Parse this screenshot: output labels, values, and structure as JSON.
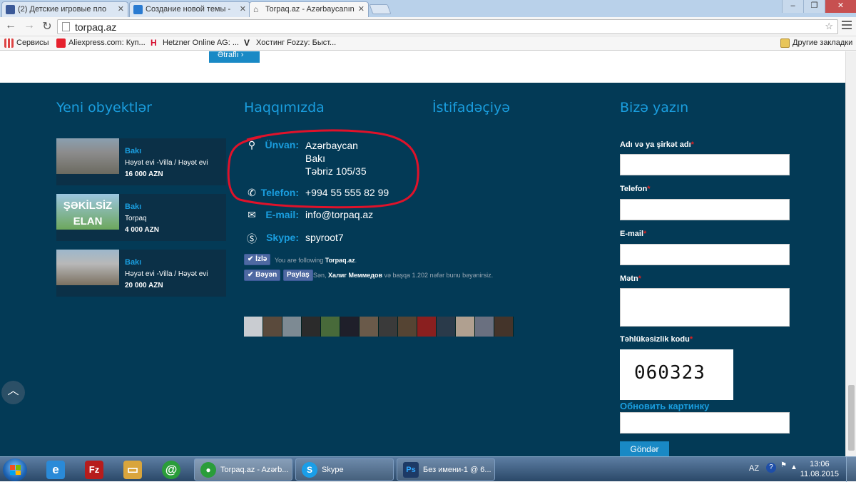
{
  "browser": {
    "tabs": [
      {
        "title": "(2) Детские игровые пло",
        "icon_color": "#3b5998",
        "icon": "facebook-icon"
      },
      {
        "title": "Создание новой темы - ",
        "icon_color": "#2a7bd1",
        "icon": "forum-icon"
      },
      {
        "title": "Torpaq.az - Azərbaycanın",
        "icon_color": "#555555",
        "icon": "home-icon"
      }
    ],
    "url": "torpaq.az",
    "bookmarks": [
      {
        "label": "Сервисы",
        "icon": "apps-icon",
        "color": "#d44"
      },
      {
        "label": "Aliexpress.com: Куп...",
        "icon": "aliexpress-icon",
        "color": "#e6212d"
      },
      {
        "label": "Hetzner Online AG: ...",
        "icon": "hetzner-icon",
        "color": "#d50c2d"
      },
      {
        "label": "Хостинг Fozzy: Быст...",
        "icon": "fozzy-icon",
        "color": "#222222"
      }
    ],
    "other_bookmarks": "Другие закладки"
  },
  "page": {
    "cut_button_label": "Ətraflı",
    "columns": {
      "objects_title": "Yeni obyektlər",
      "about_title": "Haqqımızda",
      "user_title": "İstifadəçiyə",
      "contact_title": "Bizə yazın"
    },
    "listings": [
      {
        "city": "Bakı",
        "type": "Həyət evi -Villa / Həyət evi",
        "price": "16 000 AZN",
        "thumb": "house1"
      },
      {
        "city": "Bakı",
        "type": "Torpaq",
        "price": "4 000 AZN",
        "thumb": "sekilsiz",
        "thumb_text": "ŞƏKİLSİZ ELAN"
      },
      {
        "city": "Bakı",
        "type": "Həyət evi -Villa / Həyət evi",
        "price": "20 000 AZN",
        "thumb": "house2"
      }
    ],
    "contact": {
      "address_label": "Ünvan:",
      "address_line1": "Azərbaycan",
      "address_line2": "Bakı",
      "address_line3": "Təbriz 105/35",
      "phone_label": "Telefon:",
      "phone_value": "+994 55 555 82 99",
      "email_label": "E-mail:",
      "email_value": "info@torpaq.az",
      "skype_label": "Skype:",
      "skype_value": "spyroot7"
    },
    "facebook": {
      "follow_btn": "İzlə",
      "follow_text": "You are following",
      "follow_page": "Torpaq.az",
      "like_btn": "Bəyən",
      "share_btn": "Paylaş",
      "like_text_prefix": "Sən,",
      "like_name": "Халиг Меммедов",
      "like_text_suffix": "və başqa 1.202 nəfər bunu bəyənirsiz.",
      "face_colors": [
        "#c9ccd1",
        "#5a4a3c",
        "#7d8a93",
        "#2b2b2b",
        "#486a3a",
        "#1f1f2a",
        "#6a5a4a",
        "#3a3a3a",
        "#554433",
        "#8a1f1f",
        "#2a3a4a",
        "#b0a090",
        "#6a7080",
        "#44342a",
        "#907868",
        "#d0a8a0",
        "#3d2a2a",
        "#2a2a2a",
        "#5c4c3c",
        "#38302a"
      ]
    },
    "form": {
      "name_label": "Adı və ya şirkət adı",
      "phone_label": "Telefon",
      "email_label": "E-mail",
      "text_label": "Mətn",
      "security_label": "Təhlükəsizlik kodu",
      "required_mark": "*",
      "captcha_text": "060323",
      "refresh_link": "Обновить картинку",
      "send_button": "Göndər"
    }
  },
  "taskbar": {
    "pinned": [
      {
        "icon": "ie-icon",
        "glyph": "e",
        "color": "#2a8ad8"
      },
      {
        "icon": "filezilla-icon",
        "glyph": "Fz",
        "color": "#b71c1c"
      },
      {
        "icon": "explorer-icon",
        "glyph": "▭",
        "color": "#d9a53c"
      },
      {
        "icon": "at-mail-icon",
        "glyph": "@",
        "color": "#2a9d3a"
      }
    ],
    "tasks": [
      {
        "label": "Torpaq.az - Azərb...",
        "icon": "chrome-icon",
        "glyph": "●",
        "color": "#2a9d3a"
      },
      {
        "label": "Skype",
        "icon": "skype-icon",
        "glyph": "S",
        "color": "#1a9ee8"
      },
      {
        "label": "Без имени-1 @ 6...",
        "icon": "photoshop-icon",
        "glyph": "Ps",
        "color": "#1d3a66"
      }
    ],
    "lang": "AZ",
    "time": "13:06",
    "date": "11.08.2015"
  },
  "colors": {
    "footer_bg": "#033a56",
    "accent_blue": "#1a9edf",
    "highlight_red": "#e0122a"
  }
}
